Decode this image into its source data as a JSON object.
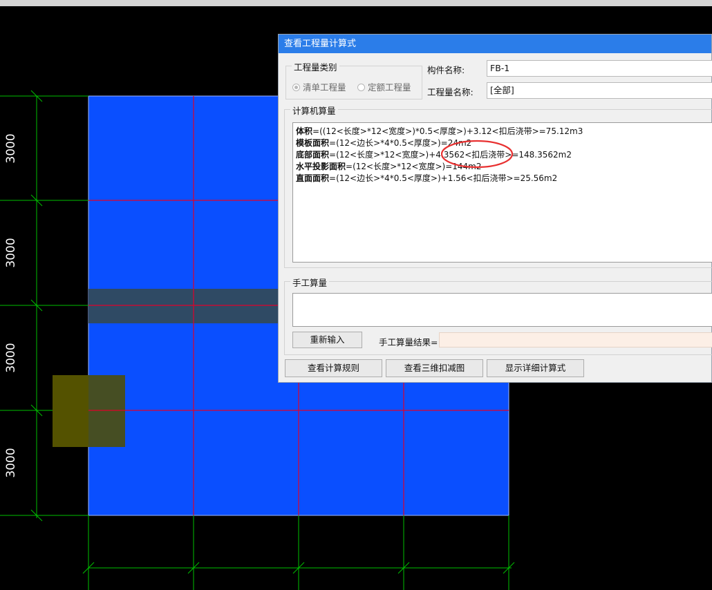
{
  "dimensions": {
    "left": [
      "3000",
      "3000",
      "3000",
      "3000"
    ]
  },
  "dialog": {
    "title": "查看工程量计算式",
    "quantity_type": {
      "group_title": "工程量类别",
      "options": [
        "清单工程量",
        "定额工程量"
      ],
      "selected": "清单工程量"
    },
    "component_name": {
      "label": "构件名称:",
      "value": "FB-1"
    },
    "quantity_name": {
      "label": "工程量名称:",
      "value": "[全部]"
    },
    "computer_calc": {
      "group_title": "计算机算量",
      "lines": [
        {
          "name": "体积",
          "expr": "=((12<长度>*12<宽度>)*0.5<厚度>)+3.12<扣后浇带>=75.12m3"
        },
        {
          "name": "模板面积",
          "expr": "=(12<边长>*4*0.5<厚度>)=24m2"
        },
        {
          "name": "底部面积",
          "expr": "=(12<长度>*12<宽度>)+4.3562<扣后浇带>=148.3562m2"
        },
        {
          "name": "水平投影面积",
          "expr": "=(12<长度>*12<宽度>)=144m2"
        },
        {
          "name": "直面面积",
          "expr": "=(12<边长>*4*0.5<厚度>)+1.56<扣后浇带>=25.56m2"
        }
      ]
    },
    "manual_calc": {
      "group_title": "手工算量",
      "reenter_button": "重新输入",
      "result_label": "手工算量结果=",
      "result_value": ""
    },
    "buttons": {
      "view_rules": "查看计算规则",
      "view_3d": "查看三维扣减图",
      "show_detail": "显示详细计算式"
    }
  },
  "colors": {
    "slab": "#0a4fff",
    "axis_line": "#e0002a",
    "dimension_line": "#00c000",
    "post_pour_strip": "#2f4a64",
    "column": "#545200",
    "dialog_title_bar": "#2b7de9",
    "highlight_circle": "#e83030"
  }
}
